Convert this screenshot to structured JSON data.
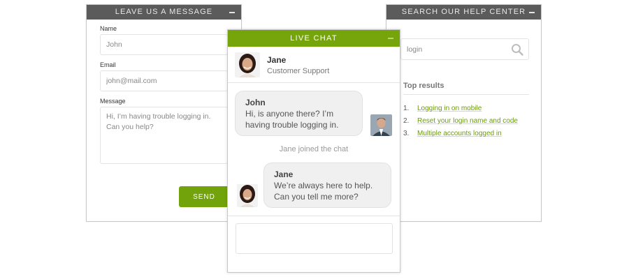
{
  "message_form": {
    "title": "LEAVE US A MESSAGE",
    "name_label": "Name",
    "name_value": "John",
    "email_label": "Email",
    "email_value": "john@mail.com",
    "message_label": "Message",
    "message_value": "Hi, I’m having trouble logging in.\nCan you help?",
    "send_label": "SEND"
  },
  "help_center": {
    "title": "SEARCH OUR HELP CENTER",
    "search_value": "login",
    "results_title": "Top results",
    "results": [
      {
        "num": "1.",
        "label": "Logging in on mobile"
      },
      {
        "num": "2.",
        "label": "Reset your login name and code"
      },
      {
        "num": "3.",
        "label": "Multiple accounts logged in"
      }
    ]
  },
  "live_chat": {
    "title": "LIVE CHAT",
    "agent_name": "Jane",
    "agent_role": "Customer Support",
    "messages": [
      {
        "sender": "John",
        "text": "Hi, is anyone there? I’m having trouble logging in."
      },
      {
        "system": "Jane joined the chat"
      },
      {
        "sender": "Jane",
        "text": "We’re always here to help. Can you tell me more?"
      }
    ],
    "composer_value": ""
  },
  "colors": {
    "accent": "#76a40b",
    "header_gray": "#5b5b5b",
    "link": "#6c9b0d"
  }
}
